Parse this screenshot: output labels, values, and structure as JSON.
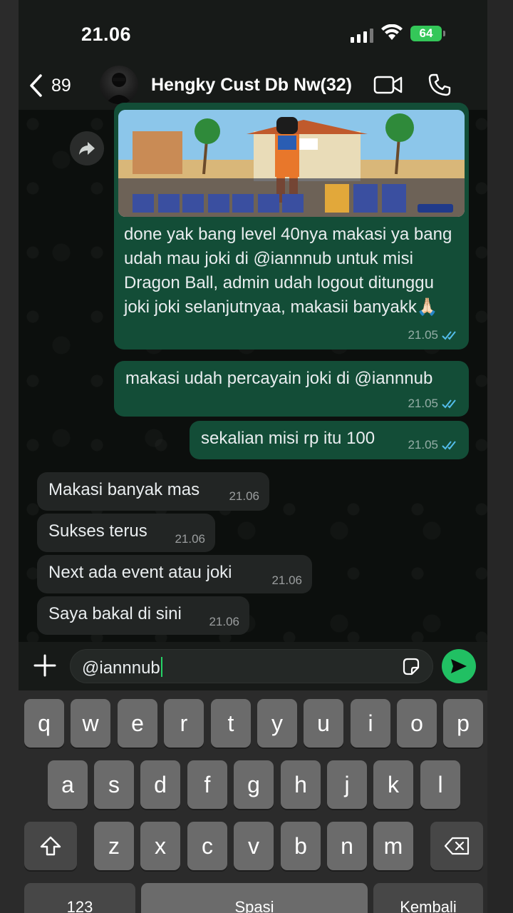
{
  "status_bar": {
    "time": "21.06",
    "battery": "64"
  },
  "header": {
    "back_count": "89",
    "title": "Hengky Cust Db Nw(32)"
  },
  "messages": [
    {
      "direction": "out",
      "has_image": true,
      "text": "done yak bang level 40nya makasi ya bang udah mau joki di @iannnub untuk misi Dragon Ball, admin udah logout ditunggu joki joki selanjutnyaa, makasii banyakk🙏🏻",
      "time": "21.05",
      "status": "read"
    },
    {
      "direction": "out",
      "text": "makasi udah percayain joki di @iannnub",
      "time": "21.05",
      "status": "read"
    },
    {
      "direction": "out",
      "text": "sekalian misi rp itu 100",
      "time": "21.05",
      "status": "read"
    },
    {
      "direction": "in",
      "text": "Makasi banyak mas",
      "time": "21.06"
    },
    {
      "direction": "in",
      "text": "Sukses terus",
      "time": "21.06"
    },
    {
      "direction": "in",
      "text": "Next ada event atau joki",
      "time": "21.06"
    },
    {
      "direction": "in",
      "text": "Saya bakal di sini",
      "time": "21.06"
    }
  ],
  "composer": {
    "value": "@iannnub"
  },
  "keyboard": {
    "row1": [
      "q",
      "w",
      "e",
      "r",
      "t",
      "y",
      "u",
      "i",
      "o",
      "p"
    ],
    "row2": [
      "a",
      "s",
      "d",
      "f",
      "g",
      "h",
      "j",
      "k",
      "l"
    ],
    "row3": [
      "z",
      "x",
      "c",
      "v",
      "b",
      "n",
      "m"
    ],
    "numbers_label": "123",
    "space_label": "Spasi",
    "return_label": "Kembali"
  },
  "colors": {
    "outgoing_bubble": "#134d37",
    "incoming_bubble": "#222524",
    "accent_green": "#21c063",
    "read_ticks": "#53bdeb"
  },
  "icons": [
    "back-chevron-icon",
    "video-call-icon",
    "phone-icon",
    "forward-icon",
    "read-ticks-icon",
    "plus-icon",
    "sticker-icon",
    "send-icon",
    "shift-icon",
    "backspace-icon",
    "signal-icon",
    "wifi-icon",
    "battery-icon"
  ]
}
